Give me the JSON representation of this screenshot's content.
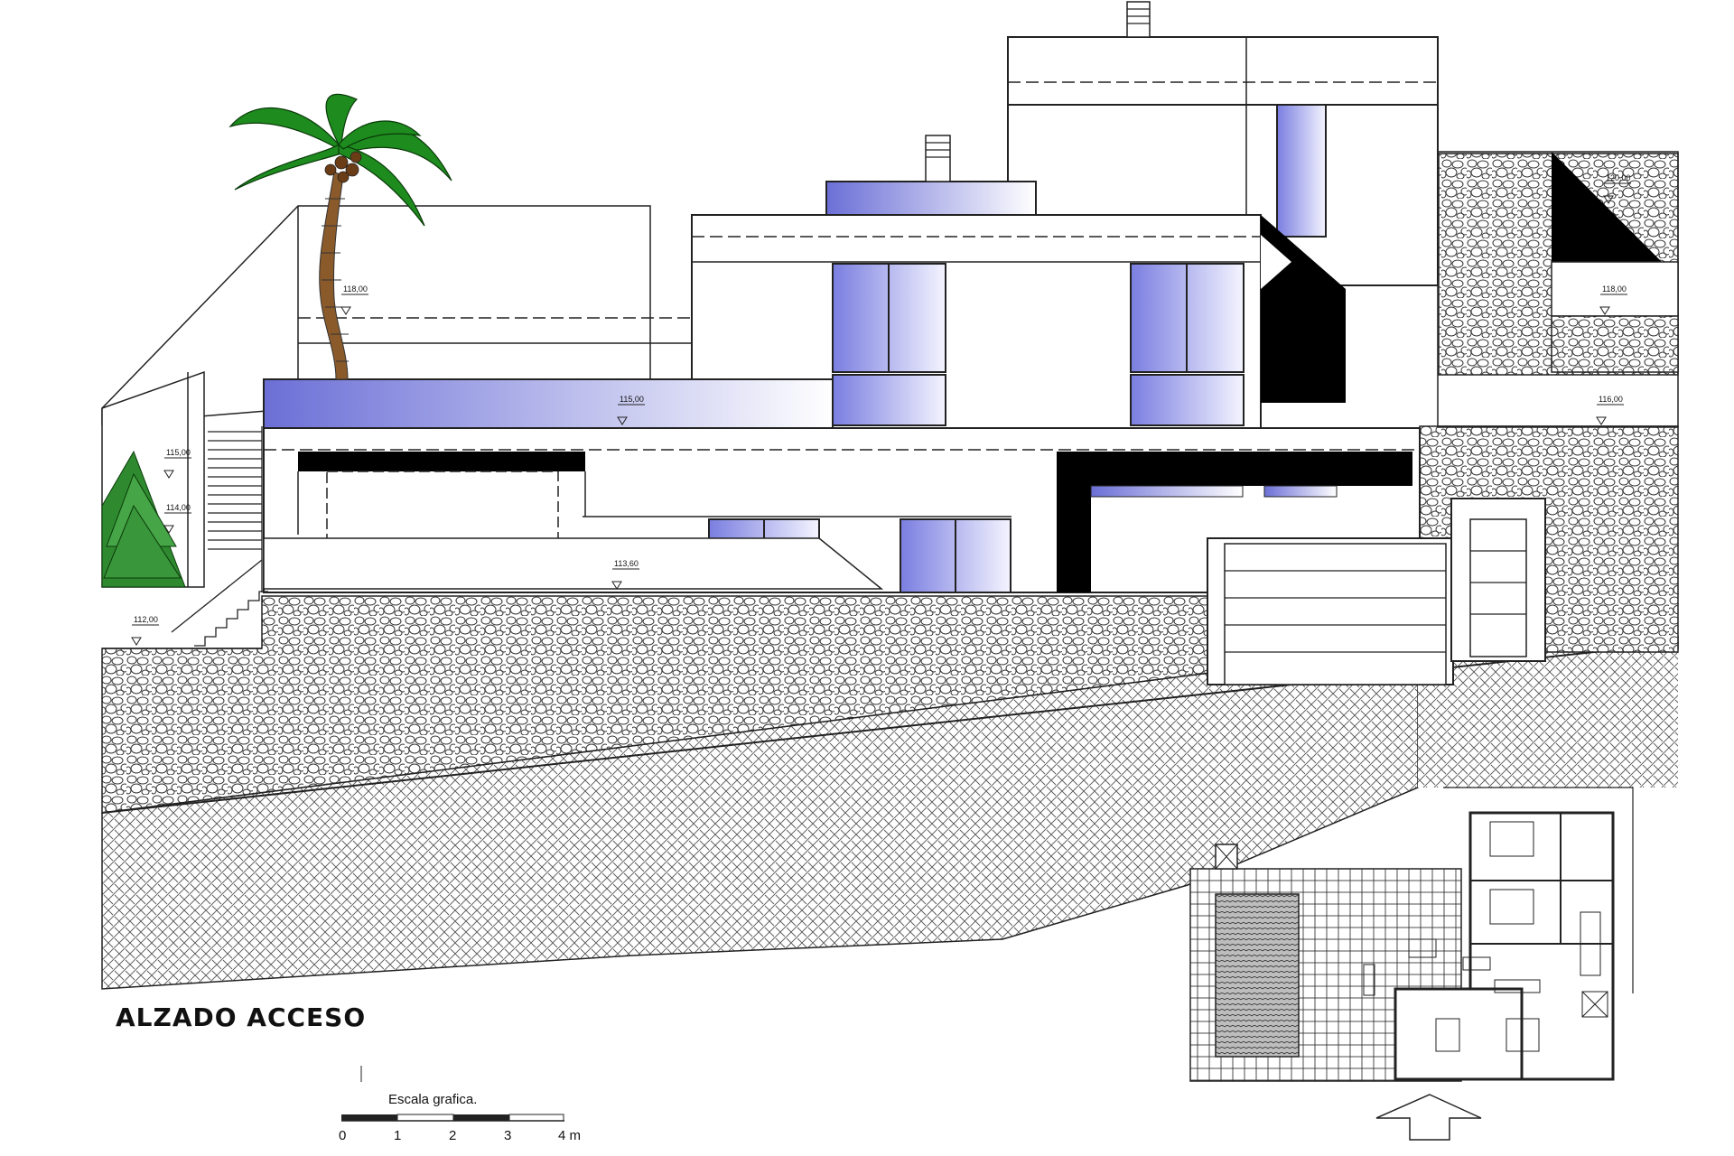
{
  "drawing": {
    "title": "ALZADO ACCESO",
    "colors": {
      "glass": "#6b6fd6",
      "stone_stroke": "#333333",
      "palm": "#1e8b1e",
      "tree": "#2f8a2f"
    }
  },
  "levels": [
    "118,00",
    "115,00",
    "115,00",
    "114,00",
    "113,60",
    "112,00",
    "120,00",
    "118,00",
    "116,00"
  ],
  "scale_bar": {
    "caption": "Escala grafica.",
    "ticks": [
      "0",
      "1",
      "2",
      "3",
      "4 m"
    ]
  },
  "key_plan": {
    "arrow": "access-direction-arrow"
  }
}
